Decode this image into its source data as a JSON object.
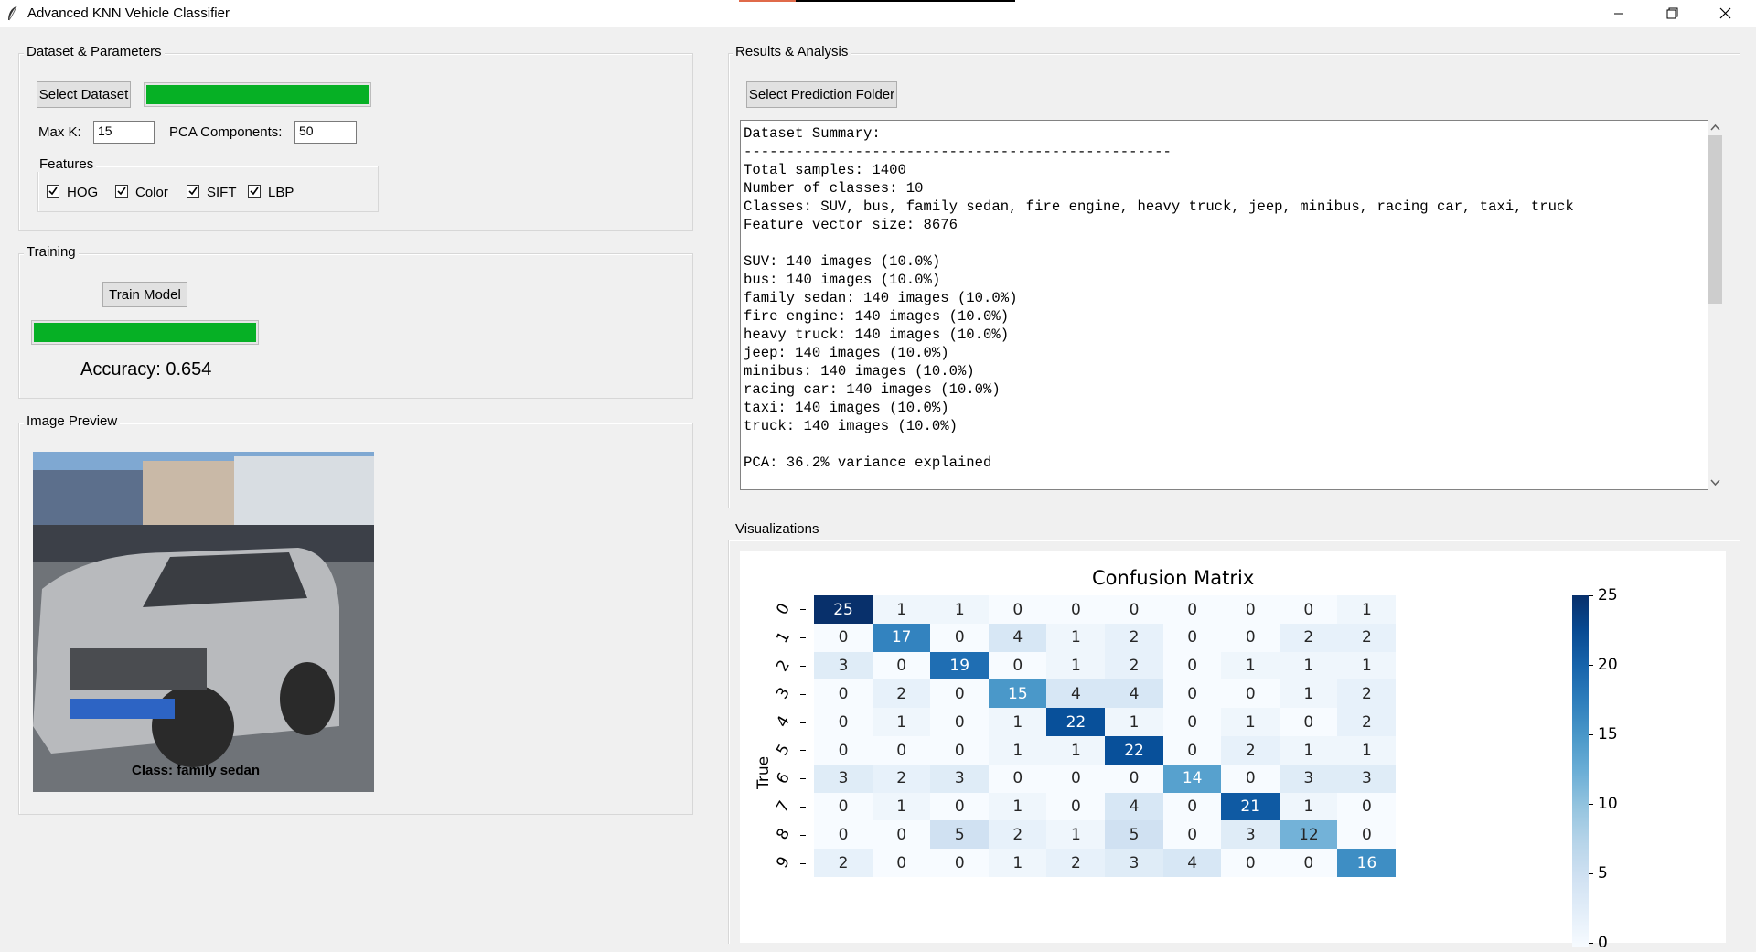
{
  "window": {
    "title": "Advanced KNN Vehicle Classifier",
    "min_icon": "minimize-icon",
    "max_icon": "restore-icon",
    "close_icon": "close-icon"
  },
  "dataset_group": {
    "title": "Dataset & Parameters",
    "select_dataset_label": "Select Dataset",
    "progress_fraction": 1.0,
    "max_k_label": "Max K:",
    "max_k_value": "15",
    "pca_label": "PCA Components:",
    "pca_value": "50",
    "features_title": "Features",
    "features": [
      {
        "label": "HOG",
        "checked": true
      },
      {
        "label": "Color",
        "checked": true
      },
      {
        "label": "SIFT",
        "checked": true
      },
      {
        "label": "LBP",
        "checked": true
      }
    ]
  },
  "training_group": {
    "title": "Training",
    "train_button_label": "Train Model",
    "progress_fraction": 1.0,
    "accuracy_text": "Accuracy: 0.654"
  },
  "preview_group": {
    "title": "Image Preview",
    "caption": "Class: family sedan"
  },
  "results_group": {
    "title": "Results & Analysis",
    "select_folder_label": "Select Prediction Folder",
    "lines": [
      "Dataset Summary:",
      "--------------------------------------------------",
      "Total samples: 1400",
      "Number of classes: 10",
      "Classes: SUV, bus, family sedan, fire engine, heavy truck, jeep, minibus, racing car, taxi, truck",
      "Feature vector size: 8676",
      "",
      "SUV: 140 images (10.0%)",
      "bus: 140 images (10.0%)",
      "family sedan: 140 images (10.0%)",
      "fire engine: 140 images (10.0%)",
      "heavy truck: 140 images (10.0%)",
      "jeep: 140 images (10.0%)",
      "minibus: 140 images (10.0%)",
      "racing car: 140 images (10.0%)",
      "taxi: 140 images (10.0%)",
      "truck: 140 images (10.0%)",
      "",
      "PCA: 36.2% variance explained"
    ]
  },
  "viz_group": {
    "title": "Visualizations"
  },
  "chart_data": {
    "type": "heatmap",
    "title": "Confusion Matrix",
    "ylabel": "True",
    "xlabel": "",
    "row_labels": [
      "0",
      "1",
      "2",
      "3",
      "4",
      "5",
      "6",
      "7",
      "8",
      "9"
    ],
    "matrix": [
      [
        25,
        1,
        1,
        0,
        0,
        0,
        0,
        0,
        0,
        1
      ],
      [
        0,
        17,
        0,
        4,
        1,
        2,
        0,
        0,
        2,
        2
      ],
      [
        3,
        0,
        19,
        0,
        1,
        2,
        0,
        1,
        1,
        1
      ],
      [
        0,
        2,
        0,
        15,
        4,
        4,
        0,
        0,
        1,
        2
      ],
      [
        0,
        1,
        0,
        1,
        22,
        1,
        0,
        1,
        0,
        2
      ],
      [
        0,
        0,
        0,
        1,
        1,
        22,
        0,
        2,
        1,
        1
      ],
      [
        3,
        2,
        3,
        0,
        0,
        0,
        14,
        0,
        3,
        3
      ],
      [
        0,
        1,
        0,
        1,
        0,
        4,
        0,
        21,
        1,
        0
      ],
      [
        0,
        0,
        5,
        2,
        1,
        5,
        0,
        3,
        12,
        0
      ],
      [
        2,
        0,
        0,
        1,
        2,
        3,
        4,
        0,
        0,
        16
      ]
    ],
    "colormap": "Blues",
    "vmin": 0,
    "vmax": 25,
    "colorbar_ticks": [
      25,
      20,
      15,
      10,
      5,
      0
    ]
  }
}
